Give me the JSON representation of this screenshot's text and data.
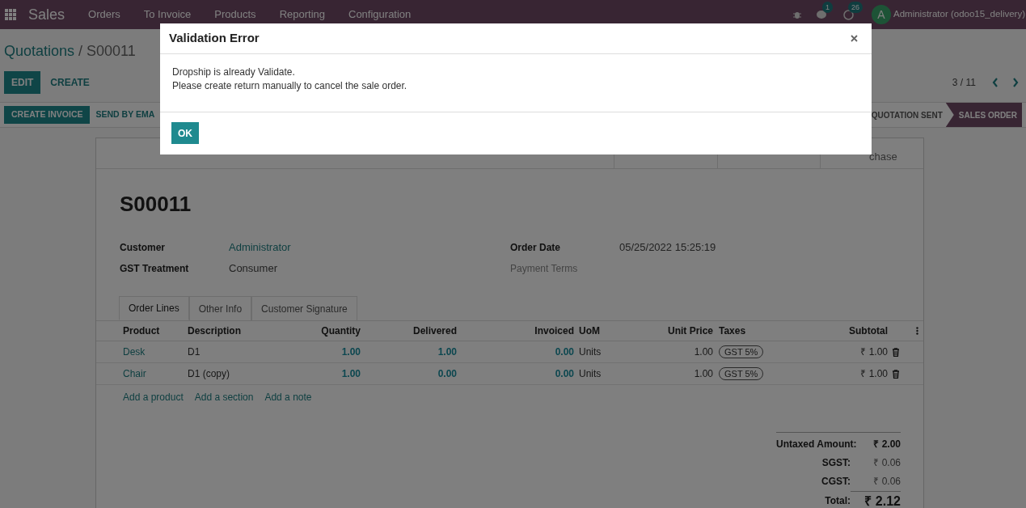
{
  "nav": {
    "app": "Sales",
    "menu": [
      "Orders",
      "To Invoice",
      "Products",
      "Reporting",
      "Configuration"
    ],
    "activity_count": "1",
    "message_count": "26",
    "user_initial": "A",
    "user_name": "Administrator (odoo15_delivery)"
  },
  "breadcrumb": {
    "parent": "Quotations",
    "separator": "/",
    "current": "S00011"
  },
  "actions": [
    {
      "label": "EDIT",
      "primary": true
    },
    {
      "label": "CREATE",
      "primary": false
    }
  ],
  "pager": "3 / 11",
  "header_buttons": [
    {
      "label": "CREATE INVOICE",
      "primary": true
    },
    {
      "label": "SEND BY EMA",
      "primary": false
    }
  ],
  "status_steps": [
    {
      "label": "QUOTATION SENT",
      "selected": false
    },
    {
      "label": "SALES ORDER",
      "selected": true
    }
  ],
  "smart_button": "chase",
  "order": {
    "name": "S00011",
    "fields_left": [
      {
        "label": "Customer",
        "value": "Administrator",
        "link": true
      },
      {
        "label": "GST Treatment",
        "value": "Consumer",
        "link": false
      }
    ],
    "fields_right": [
      {
        "label": "Order Date",
        "value": "05/25/2022 15:25:19",
        "muted": false
      },
      {
        "label": "Payment Terms",
        "muted": true
      }
    ]
  },
  "tabs": [
    {
      "label": "Order Lines",
      "selected": true
    },
    {
      "label": "Other Info",
      "selected": false
    },
    {
      "label": "Customer Signature",
      "selected": false
    }
  ],
  "table": {
    "columns": [
      "Product",
      "Description",
      "Quantity",
      "Delivered",
      "Invoiced",
      "UoM",
      "Unit Price",
      "Taxes",
      "Subtotal"
    ],
    "rows": [
      {
        "product": "Desk",
        "description": "D1",
        "quantity": "1.00",
        "delivered": "1.00",
        "invoiced": "0.00",
        "uom": "Units",
        "unit_price": "1.00",
        "tax": "GST 5%",
        "subtotal": "₹ 1.00"
      },
      {
        "product": "Chair",
        "description": "D1 (copy)",
        "quantity": "1.00",
        "delivered": "0.00",
        "invoiced": "0.00",
        "uom": "Units",
        "unit_price": "1.00",
        "tax": "GST 5%",
        "subtotal": "₹ 1.00"
      }
    ],
    "add_links": [
      "Add a product",
      "Add a section",
      "Add a note"
    ]
  },
  "totals": [
    {
      "label": "Untaxed Amount:",
      "value": "₹ 2.00",
      "kind": "subtotal"
    },
    {
      "label": "SGST:",
      "value": "₹ 0.06",
      "kind": "tax"
    },
    {
      "label": "CGST:",
      "value": "₹ 0.06",
      "kind": "tax"
    },
    {
      "label": "Total:",
      "value": "₹ 2.12",
      "kind": "total"
    }
  ],
  "dialog": {
    "title": "Validation Error",
    "lines": [
      "Dropship is already Validate.",
      "Please create return manually to cancel the sale order."
    ],
    "button": "OK"
  }
}
